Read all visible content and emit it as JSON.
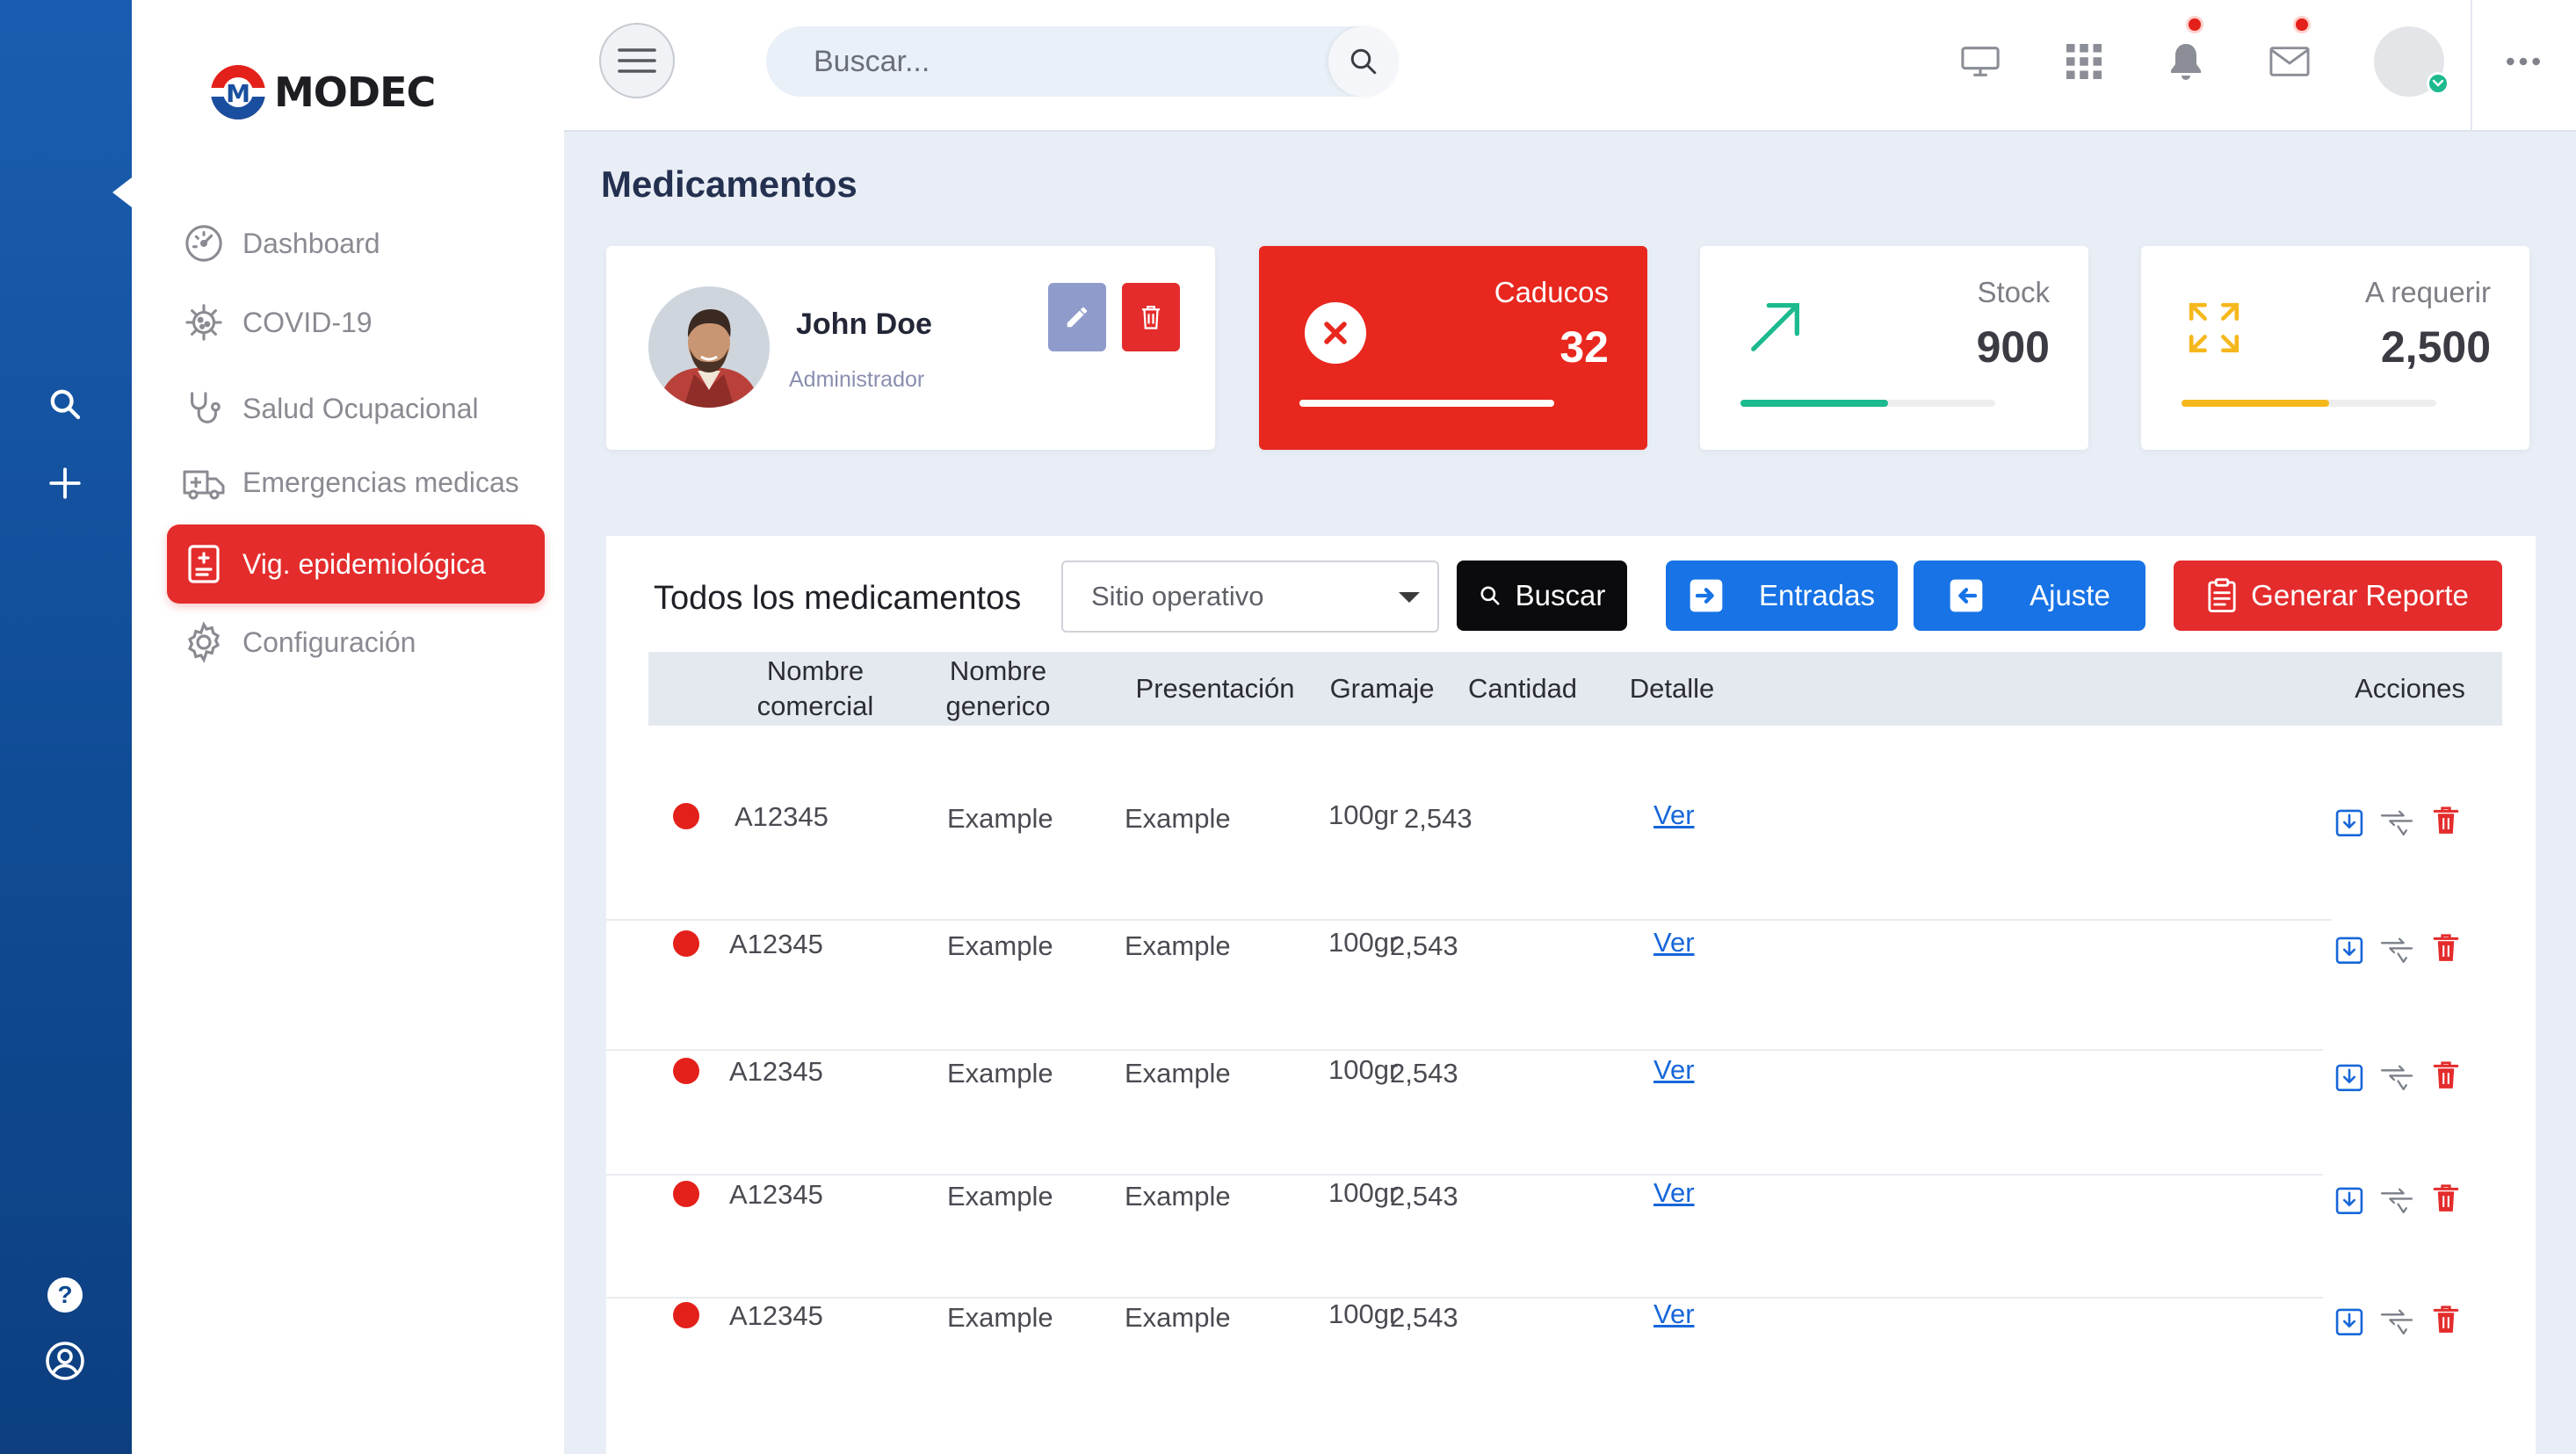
{
  "brand": {
    "logo_text": "MODEC",
    "logo_mark": "M"
  },
  "colors": {
    "rail": "#1a5db0",
    "accent_red": "#e42c2c",
    "primary_blue": "#1773e6",
    "stock_green": "#1cba8e",
    "require_yellow": "#f5b81c"
  },
  "rail": {
    "icons": [
      "search-icon",
      "plus-icon",
      "help-icon",
      "user-circle-icon"
    ],
    "help_glyph": "?"
  },
  "sidebar": {
    "items": [
      {
        "label": "Dashboard",
        "icon": "gauge-icon",
        "active": false
      },
      {
        "label": "COVID-19",
        "icon": "virus-icon",
        "active": false
      },
      {
        "label": "Salud Ocupacional",
        "icon": "stethoscope-icon",
        "active": false
      },
      {
        "label": "Emergencias medicas",
        "icon": "ambulance-icon",
        "active": false
      },
      {
        "label": "Vig. epidemiológica",
        "icon": "clipboard-icon",
        "active": true
      },
      {
        "label": "Configuración",
        "icon": "gear-icon",
        "active": false
      }
    ]
  },
  "header": {
    "search_placeholder": "Buscar...",
    "icons": [
      "monitor-icon",
      "grid-icon",
      "bell-icon",
      "mail-icon",
      "more-icon"
    ]
  },
  "page": {
    "title": "Medicamentos"
  },
  "profile": {
    "name": "John Doe",
    "role": "Administrador"
  },
  "stats": [
    {
      "label": "Caducos",
      "value": "32",
      "progress": 1.0,
      "icon": "x-circle-icon"
    },
    {
      "label": "Stock",
      "value": "900",
      "progress": 0.58,
      "icon": "trend-up-icon"
    },
    {
      "label": "A requerir",
      "value": "2,500",
      "progress": 0.58,
      "icon": "expand-arrows-icon"
    }
  ],
  "table_panel": {
    "title": "Todos los medicamentos",
    "filter": {
      "selected": "Sitio operativo"
    },
    "buttons": {
      "search": "Buscar",
      "entries": "Entradas",
      "adjust": "Ajuste",
      "report": "Generar Reporte"
    },
    "columns": {
      "commercial": "Nombre comercial",
      "generic": "Nombre generico",
      "presentation": "Presentación",
      "weight": "Gramaje",
      "quantity": "Cantidad",
      "detail": "Detalle",
      "actions": "Acciones"
    },
    "rows": [
      {
        "code": "A12345",
        "generic": "Example",
        "presentation": "Example",
        "weight": "100gr",
        "quantity": "2,543",
        "detail": "Ver"
      },
      {
        "code": "A12345",
        "generic": "Example",
        "presentation": "Example",
        "weight": "100gr",
        "quantity": "2,543",
        "detail": "Ver"
      },
      {
        "code": "A12345",
        "generic": "Example",
        "presentation": "Example",
        "weight": "100gr",
        "quantity": "2,543",
        "detail": "Ver"
      },
      {
        "code": "A12345",
        "generic": "Example",
        "presentation": "Example",
        "weight": "100gr",
        "quantity": "2,543",
        "detail": "Ver"
      },
      {
        "code": "A12345",
        "generic": "Example",
        "presentation": "Example",
        "weight": "100gr",
        "quantity": "2,543",
        "detail": "Ver"
      }
    ]
  }
}
